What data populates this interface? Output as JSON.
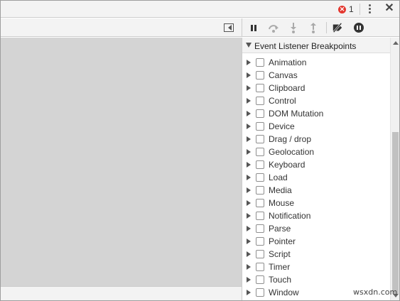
{
  "topbar": {
    "error_count": "1",
    "error_icon_glyph": "✕",
    "menu_icon": "vertical-dots-icon",
    "close_glyph": "✕"
  },
  "toolbar": {
    "icons": [
      "toggle-sidebar-icon",
      "pause-icon",
      "step-over-icon",
      "step-into-icon",
      "step-out-icon",
      "deactivate-breakpoints-icon",
      "pause-on-exceptions-icon"
    ]
  },
  "sidebar": {
    "section_title": "Event Listener Breakpoints",
    "categories": [
      {
        "label": "Animation"
      },
      {
        "label": "Canvas"
      },
      {
        "label": "Clipboard"
      },
      {
        "label": "Control"
      },
      {
        "label": "DOM Mutation"
      },
      {
        "label": "Device"
      },
      {
        "label": "Drag / drop"
      },
      {
        "label": "Geolocation"
      },
      {
        "label": "Keyboard"
      },
      {
        "label": "Load"
      },
      {
        "label": "Media"
      },
      {
        "label": "Mouse"
      },
      {
        "label": "Notification"
      },
      {
        "label": "Parse"
      },
      {
        "label": "Pointer"
      },
      {
        "label": "Script"
      },
      {
        "label": "Timer"
      },
      {
        "label": "Touch"
      },
      {
        "label": "Window"
      }
    ]
  },
  "colors": {
    "error_red": "#e4372f",
    "panel_gray": "#d4d4d4",
    "toolbar_bg": "#f3f3f3"
  },
  "watermark": "wsxdn.com"
}
